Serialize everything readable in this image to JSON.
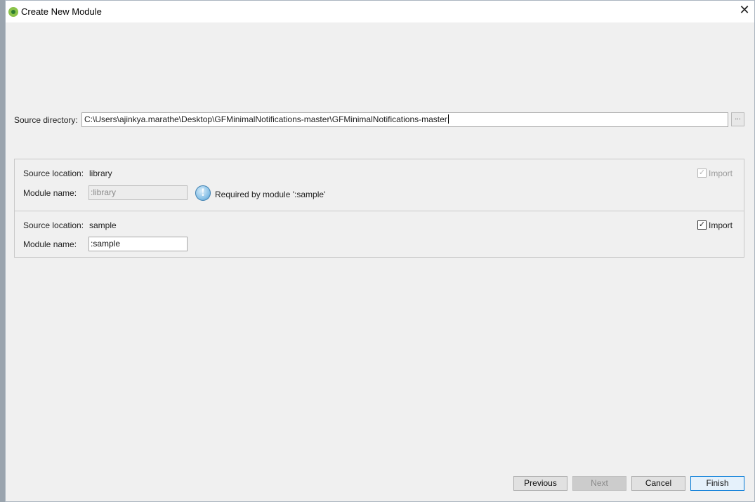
{
  "window": {
    "title": "Create New Module",
    "close_label": "✕"
  },
  "source": {
    "label": "Source directory:",
    "value": "C:\\Users\\ajinkya.marathe\\Desktop\\GFMinimalNotifications-master\\GFMinimalNotifications-master",
    "browse_label": "..."
  },
  "modules": [
    {
      "location_label": "Source location:",
      "location": "library",
      "name_label": "Module name:",
      "name": ":library",
      "name_enabled": false,
      "import_label": "Import",
      "import_checked": true,
      "import_enabled": false,
      "warning": "Required by module ':sample'"
    },
    {
      "location_label": "Source location:",
      "location": "sample",
      "name_label": "Module name:",
      "name": ":sample",
      "name_enabled": true,
      "import_label": "Import",
      "import_checked": true,
      "import_enabled": true
    }
  ],
  "buttons": {
    "previous": "Previous",
    "next": "Next",
    "cancel": "Cancel",
    "finish": "Finish"
  },
  "checkmark": "✓",
  "info_glyph": "!"
}
